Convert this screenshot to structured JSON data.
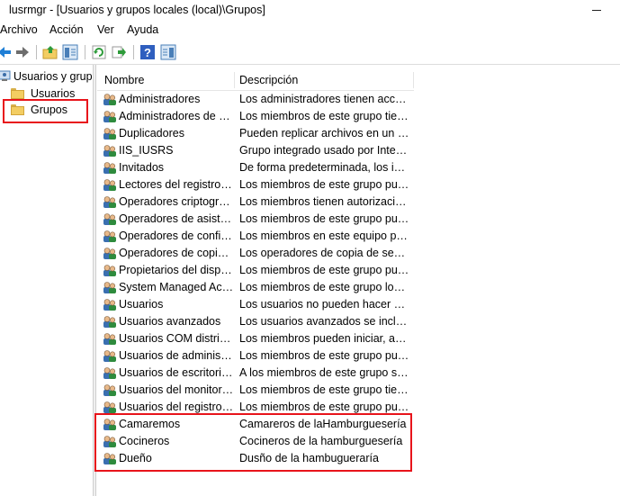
{
  "window": {
    "title": "lusrmgr - [Usuarios y grupos locales (local)\\Grupos]"
  },
  "menu": [
    {
      "label": "Archivo"
    },
    {
      "label": "Acción"
    },
    {
      "label": "Ver"
    },
    {
      "label": "Ayuda"
    }
  ],
  "toolbar": {
    "buttons": [
      "back-arrow-icon",
      "forward-arrow-icon",
      "up-folder-icon",
      "show-hide-tree-icon",
      "refresh-icon",
      "export-list-icon",
      "help-icon",
      "properties-pane-icon"
    ]
  },
  "tree": {
    "root": "Usuarios y grupos locales (local)",
    "items": [
      {
        "label": "Usuarios"
      },
      {
        "label": "Grupos"
      }
    ]
  },
  "list": {
    "columns": [
      "Nombre",
      "Descripción"
    ],
    "rows": [
      {
        "name": "Administradores",
        "desc": "Los administradores tienen acceso completo y sin restricciones al equipo o dominio"
      },
      {
        "name": "Administradores de Hyper-V",
        "desc": "Los miembros de este grupo tienen acceso completo y sin restricciones"
      },
      {
        "name": "Duplicadores",
        "desc": "Pueden replicar archivos en un dominio"
      },
      {
        "name": "IIS_IUSRS",
        "desc": "Grupo integrado usado por Internet Information Services."
      },
      {
        "name": "Invitados",
        "desc": "De forma predeterminada, los invitados tienen el mismo acceso"
      },
      {
        "name": "Lectores del registro de eventos",
        "desc": "Los miembros de este grupo pueden leer registros de eventos"
      },
      {
        "name": "Operadores criptográficos",
        "desc": "Los miembros tienen autorización para realizar operaciones criptográficas."
      },
      {
        "name": "Operadores de asistencia de control de acceso",
        "desc": "Los miembros de este grupo pueden consultar de forma remota"
      },
      {
        "name": "Operadores de configuración de red",
        "desc": "Los miembros en este equipo pueden tener algunos privilegios"
      },
      {
        "name": "Operadores de copia de seguridad",
        "desc": "Los operadores de copia de seguridad pueden invalidar restricciones"
      },
      {
        "name": "Propietarios del dispositivo",
        "desc": "Los miembros de este grupo pueden cambiar la configuración"
      },
      {
        "name": "System Managed Accounts Group",
        "desc": "Los miembros de este grupo los administra el sistema."
      },
      {
        "name": "Usuarios",
        "desc": "Los usuarios no pueden hacer cambios accidentales o intencionados"
      },
      {
        "name": "Usuarios avanzados",
        "desc": "Los usuarios avanzados se incluyen para la compatibilidad"
      },
      {
        "name": "Usuarios COM distribuidos",
        "desc": "Los miembros pueden iniciar, activar y usar objetos de COM distribuido"
      },
      {
        "name": "Usuarios de administración remota",
        "desc": "Los miembros de este grupo pueden acceder a los recursos WMI"
      },
      {
        "name": "Usuarios de escritorio remoto",
        "desc": "A los miembros de este grupo se les concede el derecho"
      },
      {
        "name": "Usuarios del monitor de sistema",
        "desc": "Los miembros de este grupo tienen acceso a los datos"
      },
      {
        "name": "Usuarios del registro de rendimiento",
        "desc": "Los miembros de este grupo pueden programar contadores"
      },
      {
        "name": "Camaremos",
        "desc": "Camareros de laHamburguesería"
      },
      {
        "name": "Cocineros",
        "desc": "Cocineros de la hamburguesería"
      },
      {
        "name": "Dueño",
        "desc": "Dusño de la hambugueraría"
      }
    ]
  },
  "colors": {
    "highlight": "#e8141b",
    "folder": "#f3cd62"
  }
}
